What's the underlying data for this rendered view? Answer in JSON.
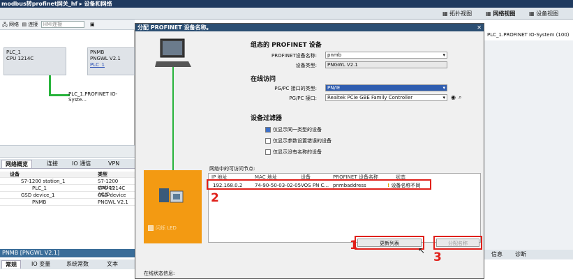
{
  "titlebar": {
    "text": "modbus转profinet网关_hf ▸ 设备和网络"
  },
  "viewtabs": [
    "拓扑视图",
    "网络视图",
    "设备视图"
  ],
  "toolbar": {
    "network": "网络",
    "connect": "连接",
    "hmi_placeholder": "HMI连接"
  },
  "canvas": {
    "plc": {
      "name": "PLC_1",
      "type": "CPU 1214C"
    },
    "pnmb": {
      "name": "PNMB",
      "type": "PNGWL V2.1",
      "link": "PLC_1"
    },
    "network_label": "PLC_1.PROFINET IO-Syste..."
  },
  "right_panel": {
    "label": "PLC_1.PROFINET IO-System (100)"
  },
  "bottom_tabs": [
    "网络概览",
    "连接",
    "IO 通信",
    "VPN"
  ],
  "overview": {
    "headers": [
      "设备",
      "类型"
    ],
    "rows": [
      {
        "device": "S7-1200 station_1",
        "type": "S7-1200 station"
      },
      {
        "device": "PLC_1",
        "type": "CPU 1214C AC/D"
      },
      {
        "device": "GSD device_1",
        "type": "GSD device"
      },
      {
        "device": "PNMB",
        "type": "PNGWL V2.1"
      }
    ]
  },
  "inspector": {
    "title": "PNMB [PNGWL V2.1]",
    "tabs": [
      "常规",
      "IO 变量",
      "系统常数",
      "文本"
    ],
    "right_tabs": [
      "信息",
      "诊断"
    ]
  },
  "dialog": {
    "title": "分配 PROFINET 设备名称。",
    "section_device": "组态的 PROFINET 设备",
    "device_name_label": "PROFINET设备名称:",
    "device_name": "pnmb",
    "device_type_label": "设备类型:",
    "device_type": "PNGWL V2.1",
    "section_online": "在线访问",
    "pgpc_type_label": "PG/PC 接口的类型:",
    "pgpc_type": "PN/IE",
    "pgpc_iface_label": "PG/PC 接口:",
    "pgpc_iface": "Realtek PCIe GBE Family Controller",
    "section_filter": "设备过滤器",
    "filter1": "仅显示同一类型的设备",
    "filter2": "仅显示参数设置错误的设备",
    "filter3": "仅显示没有名称的设备",
    "table_caption": "网络中的可访问节点:",
    "table_headers": [
      "IP 地址",
      "MAC 地址",
      "设备",
      "PROFINET 设备名称",
      "状态"
    ],
    "row": {
      "ip": "192.168.0.2",
      "mac": "74-90-50-03-02-05",
      "device": "VOS PN C...",
      "name": "pnmbaddress",
      "status": "设备名称不同"
    },
    "flash_led": "闪烁 LED",
    "refresh_button": "更新列表",
    "assign_button": "分配名称",
    "online_status": "在线状态信息:"
  },
  "annotations": [
    "1",
    "2",
    "3"
  ],
  "colors": {
    "accent_red": "#e0201a",
    "orange_panel": "#f39a12",
    "cable_green": "#28b43c"
  }
}
